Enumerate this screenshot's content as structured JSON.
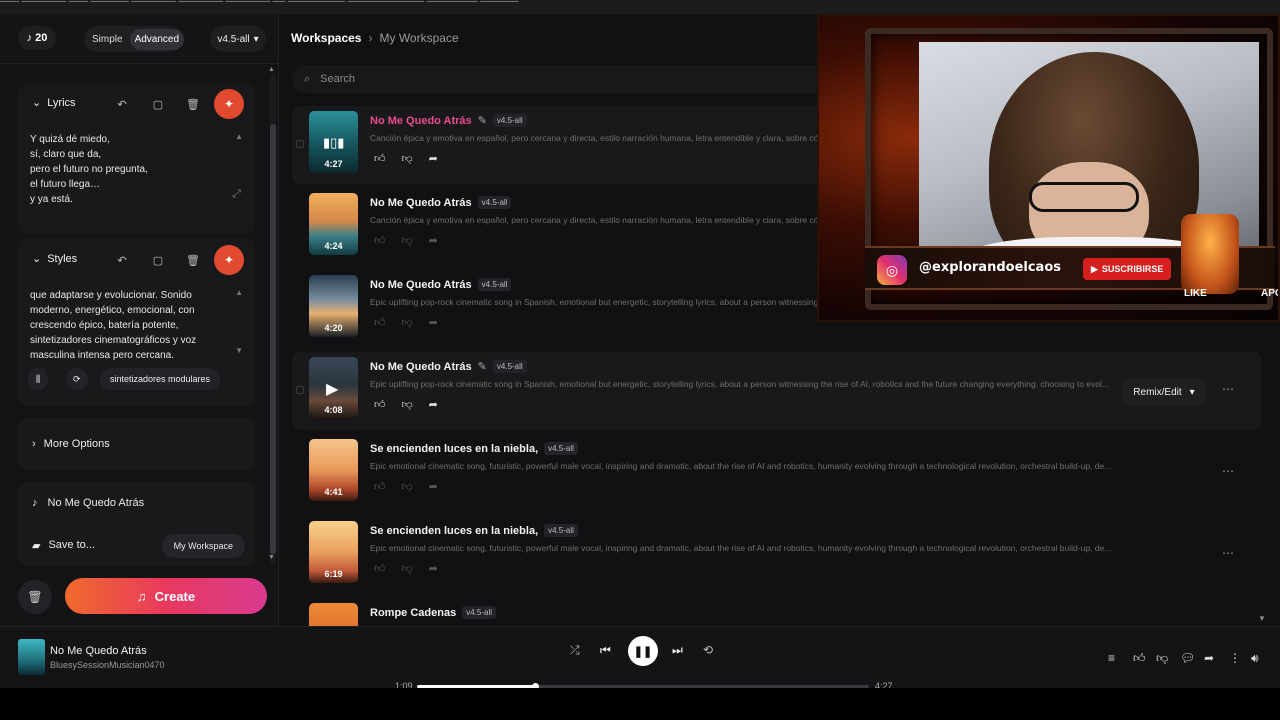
{
  "left_panel": {
    "credits": "20",
    "mode_simple": "Simple",
    "mode_advanced": "Advanced",
    "model": "v4.5-all",
    "lyrics": {
      "title": "Lyrics",
      "text": "Y quizá dé miedo,\nsí, claro que da,\npero el futuro no pregunta,\nel futuro llega…\ny ya está."
    },
    "styles": {
      "title": "Styles",
      "text": "que adaptarse y evolucionar. Sonido\nmoderno, energético, emocional, con\ncrescendo épico, batería potente,\nsintetizadores cinematográficos y voz\nmasculina intensa pero cercana.",
      "chip": "sintetizadores modulares"
    },
    "more_options": "More Options",
    "song_title": "No Me Quedo Atrás",
    "save_to_label": "Save to...",
    "save_to_value": "My Workspace",
    "create_label": "Create"
  },
  "main": {
    "breadcrumb_root": "Workspaces",
    "breadcrumb_current": "My Workspace",
    "search_placeholder": "Search",
    "remix_label": "Remix/Edit",
    "tracks": [
      {
        "title": "No Me Quedo Atrás",
        "version": "v4.5-all",
        "duration": "4:27",
        "desc": "Canción épica y emotiva en español, pero cercana y directa, estilo narración humana, letra entendible y clara, sobre cóm"
      },
      {
        "title": "No Me Quedo Atrás",
        "version": "v4.5-all",
        "duration": "4:24",
        "desc": "Canción épica y emotiva en español, pero cercana y directa, estilo narración humana, letra entendible y clara, sobre cóm"
      },
      {
        "title": "No Me Quedo Atrás",
        "version": "v4.5-all",
        "duration": "4:20",
        "desc": "Epic uplifting pop-rock cinematic song in Spanish, emotional but energetic, storytelling lyrics, about a person witnessing the rise of AI, robotics and the future changing everything, choosing to evol..."
      },
      {
        "title": "No Me Quedo Atrás",
        "version": "v4.5-all",
        "duration": "4:08",
        "desc": "Epic uplifting pop-rock cinematic song in Spanish, emotional but energetic, storytelling lyrics, about a person witnessing the rise of AI, robotics and the future changing everything, choosing to evol..."
      },
      {
        "title": "Se encienden luces en la niebla,",
        "version": "v4.5-all",
        "duration": "4:41",
        "desc": "Epic emotional cinematic song, futuristic, powerful male vocal, inspiring and dramatic, about the rise of AI and robotics, humanity evolving through a technological revolution, orchestral build-up, de..."
      },
      {
        "title": "Se encienden luces en la niebla,",
        "version": "v4.5-all",
        "duration": "6:19",
        "desc": "Epic emotional cinematic song, futuristic, powerful male vocal, inspiring and dramatic, about the rise of AI and robotics, humanity evolving through a technological revolution, orchestral build-up, de..."
      },
      {
        "title": "Rompe Cadenas",
        "version": "v4.5-all",
        "duration": "",
        "desc": ""
      }
    ]
  },
  "player": {
    "title": "No Me Quedo Atrás",
    "artist": "BluesySessionMusician0470",
    "time_current": "1:09",
    "time_total": "4:27",
    "progress": 0.26
  },
  "webcam": {
    "handle": "@explorandoelcaos",
    "subscribe": "SUSCRIBIRSE",
    "like": "LIKE",
    "apoya": "APO"
  },
  "colors": {
    "accent_pink": "#ec4a8f",
    "create_gradient_start": "#f06a2a",
    "create_gradient_end": "#d83a8e",
    "magic_button": "#e14a2f"
  }
}
